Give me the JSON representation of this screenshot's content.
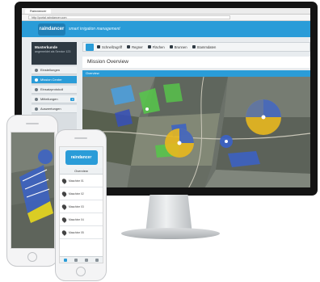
{
  "browser": {
    "tab_title": "Raindancer",
    "url": "http://portal.raindancer.com"
  },
  "app": {
    "logo_text": "raindancer",
    "tagline": "smart irrigation management",
    "brand_color": "#2a9cd8"
  },
  "sidebar": {
    "profile_name": "Musterkunde",
    "profile_sub": "angemeldet als Service 123",
    "items": [
      {
        "label": "Einstellungen",
        "icon": "gear-icon"
      },
      {
        "label": "Mission Center",
        "icon": "map-icon",
        "active": true
      },
      {
        "label": "Einsatzprotokoll",
        "icon": "log-icon"
      },
      {
        "label": "Mitteilungen",
        "icon": "message-icon",
        "badge": "3"
      },
      {
        "label": "Auswertungen",
        "icon": "chart-icon"
      }
    ]
  },
  "toolbar": {
    "buttons": [
      "Schnellzugriff",
      "Regner",
      "Flächen",
      "Brunnen",
      "Stammdaten"
    ]
  },
  "main": {
    "title": "Mission Overview",
    "section": "Overview"
  },
  "phone": {
    "logo_text": "raindancer",
    "tab_label": "Overview",
    "entries": [
      "Maschine 01",
      "Maschine 02",
      "Maschine 03",
      "Maschine 04",
      "Maschine 05"
    ]
  }
}
